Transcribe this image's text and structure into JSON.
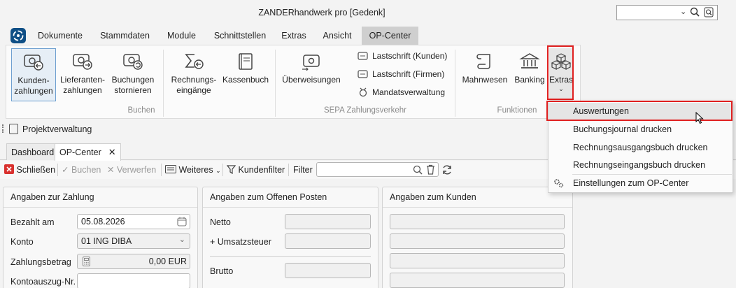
{
  "window": {
    "title": "ZANDERhandwerk pro [Gedenk]"
  },
  "quick_search": {
    "value": ""
  },
  "menu": {
    "items": [
      {
        "label": "Dokumente"
      },
      {
        "label": "Stammdaten"
      },
      {
        "label": "Module"
      },
      {
        "label": "Schnittstellen"
      },
      {
        "label": "Extras"
      },
      {
        "label": "Ansicht"
      },
      {
        "label": "OP-Center"
      }
    ],
    "active_index": 6
  },
  "ribbon": {
    "buchen": {
      "kundenzahlungen": "Kunden-\nzahlungen",
      "lieferantenzahlungen": "Lieferanten-\nzahlungen",
      "buchungen_stornieren": "Buchungen\nstornieren",
      "rechnungseingaenge": "Rechnungs-\neingänge",
      "kassenbuch": "Kassenbuch",
      "label": "Buchen"
    },
    "sepa": {
      "ueberweisungen": "Überweisungen",
      "lastschrift_kunden": "Lastschrift (Kunden)",
      "lastschrift_firmen": "Lastschrift (Firmen)",
      "mandatsverwaltung": "Mandatsverwaltung",
      "label": "SEPA Zahlungsverkehr"
    },
    "funktionen": {
      "mahnwesen": "Mahnwesen",
      "banking": "Banking",
      "extras": "Extras",
      "label": "Funktionen"
    }
  },
  "subbar": {
    "label": "Projektverwaltung"
  },
  "tabs": [
    {
      "label": "Dashboard"
    },
    {
      "label": "OP-Center"
    }
  ],
  "toolbar": {
    "schliessen": "Schließen",
    "buchen": "Buchen",
    "verwerfen": "Verwerfen",
    "weiteres": "Weiteres",
    "kundenfilter": "Kundenfilter",
    "filter_label": "Filter",
    "filter_value": ""
  },
  "zahlung": {
    "title": "Angaben zur Zahlung",
    "bezahlt_am_label": "Bezahlt am",
    "bezahlt_am_value": "05.08.2026",
    "konto_label": "Konto",
    "konto_value": "01 ING DIBA",
    "zahlungsbetrag_label": "Zahlungsbetrag",
    "zahlungsbetrag_value": "0,00 EUR",
    "kontoauszug_label": "Kontoauszug-Nr.",
    "kontoauszug_value": ""
  },
  "offener_posten": {
    "title": "Angaben zum Offenen Posten",
    "netto_label": "Netto",
    "umsatzsteuer_label": "+ Umsatzsteuer",
    "brutto_label": "Brutto"
  },
  "kunde": {
    "title": "Angaben zum Kunden"
  },
  "extras_menu": {
    "items": [
      {
        "label": "Auswertungen"
      },
      {
        "label": "Buchungsjournal drucken"
      },
      {
        "label": "Rechnungsausgangsbuch drucken"
      },
      {
        "label": "Rechnungseingangsbuch drucken"
      },
      {
        "label": "Einstellungen zum OP-Center"
      }
    ],
    "hovered_index": 0
  },
  "colors": {
    "highlight": "#e02020",
    "app_logo": "#0f4f86",
    "close_red": "#d9322f",
    "selected_border": "#6fa0d0"
  },
  "icons": [
    "search-icon",
    "gear-icon",
    "calendar-icon",
    "calculator-icon",
    "close-icon",
    "check-icon",
    "refresh-icon",
    "trash-icon",
    "filter-icon"
  ]
}
